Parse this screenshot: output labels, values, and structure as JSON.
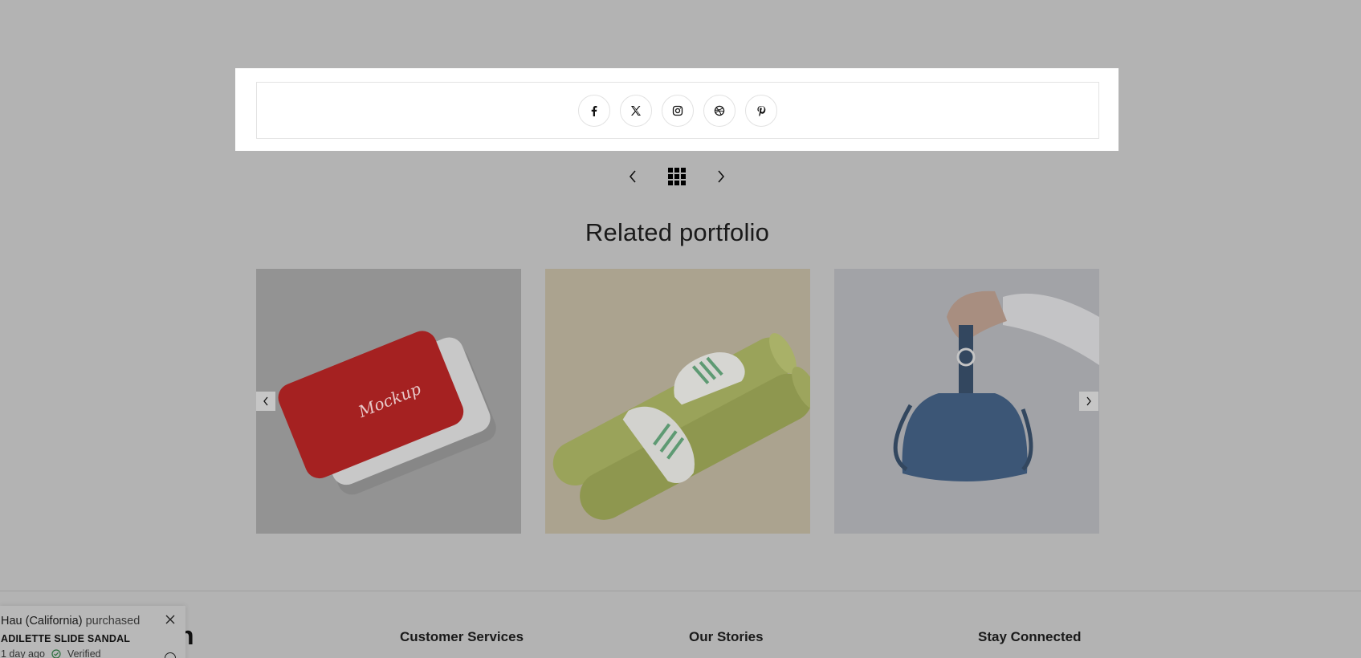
{
  "share": {
    "icons": [
      "facebook-icon",
      "x-twitter-icon",
      "instagram-icon",
      "dribbble-icon",
      "pinterest-icon"
    ]
  },
  "post_nav": {
    "prev_icon": "chevron-left-icon",
    "grid_icon": "grid-icon",
    "next_icon": "chevron-right-icon"
  },
  "related": {
    "title": "Related portfolio",
    "items": [
      {
        "image": "red business card mockup"
      },
      {
        "image": "white sneakers on green yoga mat"
      },
      {
        "image": "blue leather bucket bag held by hand"
      }
    ]
  },
  "footer": {
    "logo_fragment": "n",
    "columns": [
      "Customer Services",
      "Our Stories",
      "Stay Connected"
    ]
  },
  "popup": {
    "name": "Hau (California)",
    "action": "purchased",
    "product": "ADILETTE SLIDE SANDAL",
    "time": "1 day ago",
    "verified": "Verified"
  },
  "colors": {
    "overlay_bg": "#b3b3b3",
    "share_bg": "#ffffff"
  }
}
